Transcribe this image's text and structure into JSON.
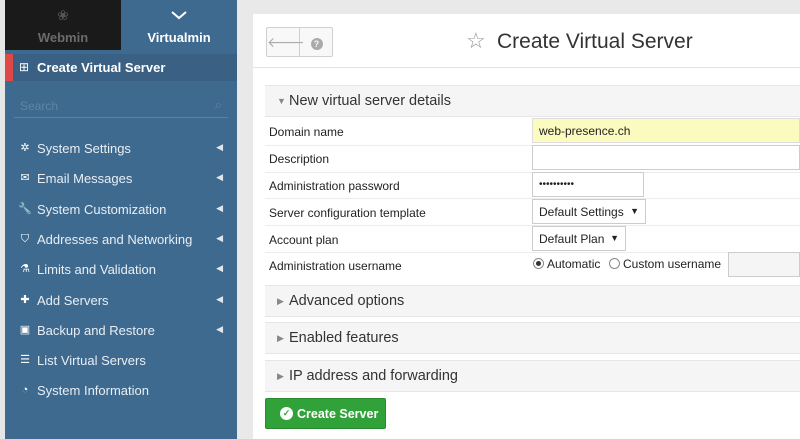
{
  "switcher": {
    "webmin_label": "Webmin",
    "virtualmin_label": "Virtualmin"
  },
  "sidebar": {
    "active_item": "Create Virtual Server",
    "search_placeholder": "Search",
    "items": [
      {
        "label": "System Settings",
        "icon": "gear-icon",
        "glyph": "✲",
        "has_arrow": true
      },
      {
        "label": "Email Messages",
        "icon": "envelope-icon",
        "glyph": "✉",
        "has_arrow": true
      },
      {
        "label": "System Customization",
        "icon": "wrench-icon",
        "glyph": "🔧",
        "has_arrow": true
      },
      {
        "label": "Addresses and Networking",
        "icon": "shield-icon",
        "glyph": "⛉",
        "has_arrow": true
      },
      {
        "label": "Limits and Validation",
        "icon": "flask-icon",
        "glyph": "⚗",
        "has_arrow": true
      },
      {
        "label": "Add Servers",
        "icon": "plus-icon",
        "glyph": "✚",
        "has_arrow": true
      },
      {
        "label": "Backup and Restore",
        "icon": "floppy-icon",
        "glyph": "▣",
        "has_arrow": true
      },
      {
        "label": "List Virtual Servers",
        "icon": "list-icon",
        "glyph": "☰",
        "has_arrow": false
      },
      {
        "label": "System Information",
        "icon": "dashboard-icon",
        "glyph": "◔",
        "has_arrow": false
      }
    ]
  },
  "colors": {
    "sidebar_bg": "#3f6a8f",
    "active_marker": "#e04848",
    "create_button": "#31a13a",
    "highlight_field": "#fbfbc0"
  },
  "page": {
    "title": "Create Virtual Server"
  },
  "sections": {
    "details": "New virtual server details",
    "advanced": "Advanced options",
    "features": "Enabled features",
    "ip": "IP address and forwarding"
  },
  "form": {
    "domain_label": "Domain name",
    "domain_value": "web-presence.ch",
    "description_label": "Description",
    "description_value": "",
    "password_label": "Administration password",
    "password_value": "••••••••••",
    "template_label": "Server configuration template",
    "template_value": "Default Settings",
    "plan_label": "Account plan",
    "plan_value": "Default Plan",
    "username_label": "Administration username",
    "username_auto": "Automatic",
    "username_custom": "Custom username",
    "username_value": ""
  },
  "actions": {
    "create_label": "Create Server"
  }
}
